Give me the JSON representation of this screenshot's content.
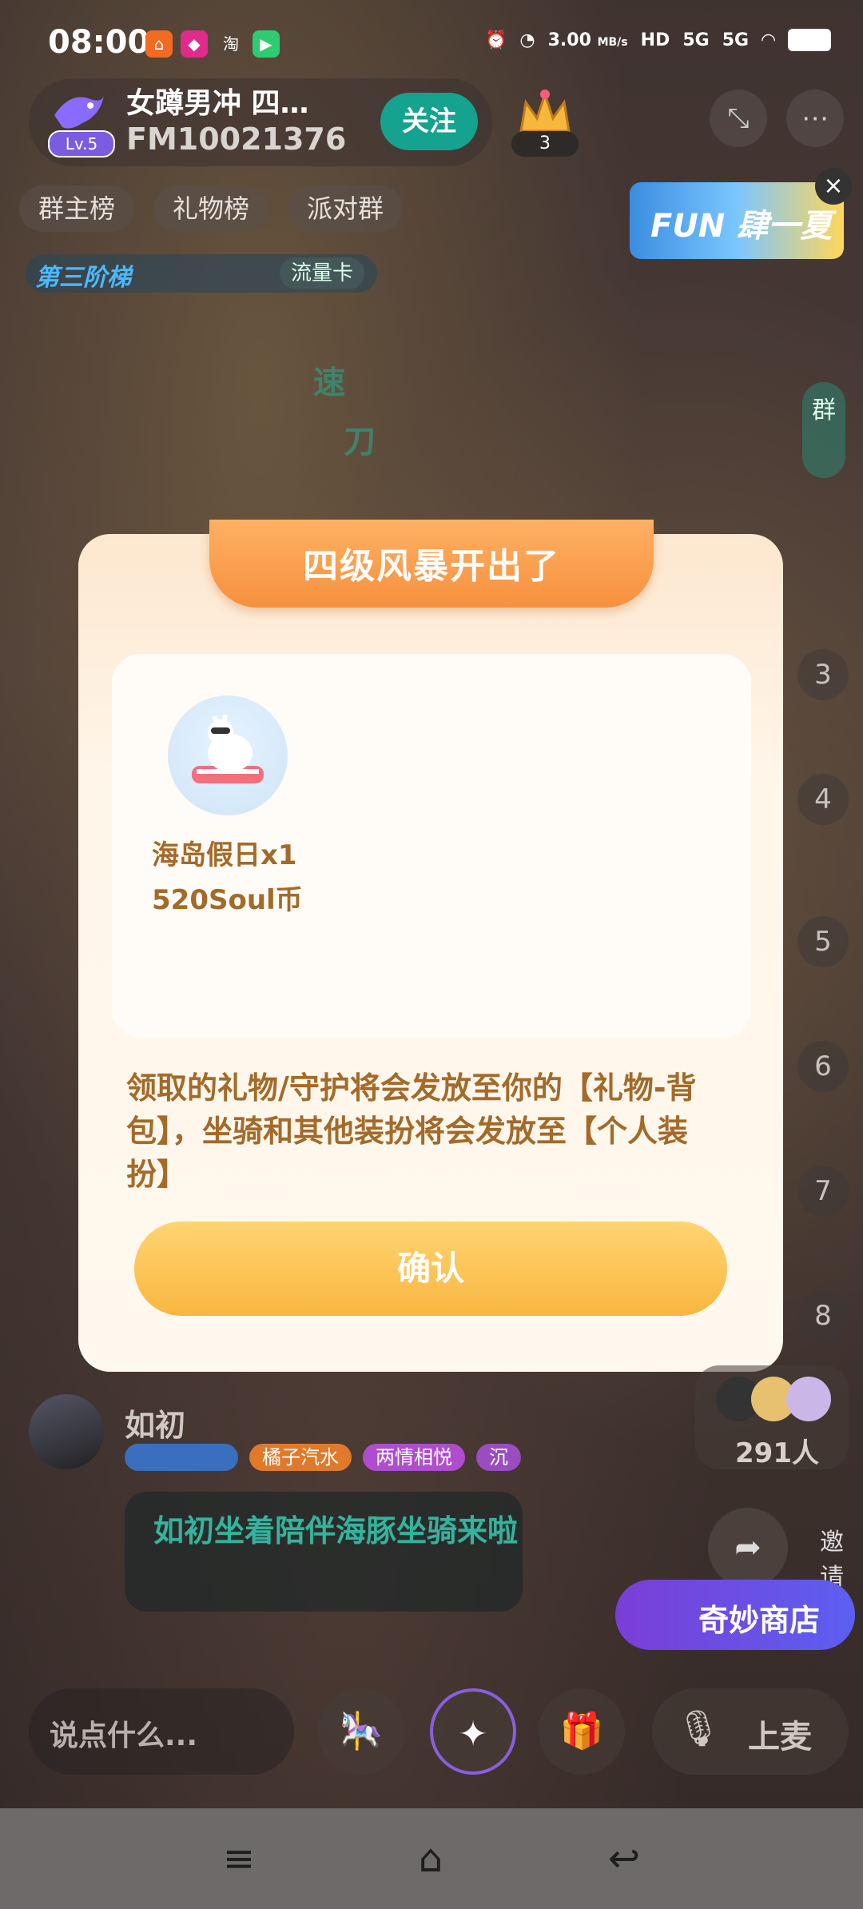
{
  "status_bar": {
    "time": "08:00",
    "app_icons": [
      "home-app-icon",
      "shop-app-icon",
      "淘",
      "video-app-icon"
    ],
    "speed": "3.00",
    "speed_unit": "MB/s",
    "network_labels": [
      "HD",
      "5G",
      "5G"
    ],
    "icons": [
      "alarm-icon",
      "speedometer-icon",
      "wifi-icon",
      "battery-icon"
    ]
  },
  "room": {
    "level": "Lv.5",
    "name": "女蹲男冲  四…",
    "id": "FM10021376",
    "follow_label": "关注",
    "crown_count": "3",
    "tabs": [
      "群主榜",
      "礼物榜",
      "派对群"
    ],
    "stage_label": "第三阶梯",
    "stage_card": "流量卡",
    "banner_text": "FUN 肆一夏",
    "close_symbol": "×",
    "bg_fragment_texts": [
      "速",
      "刀"
    ]
  },
  "mic_seats": [
    "3",
    "4",
    "5",
    "6",
    "7",
    "8"
  ],
  "side_labels": {
    "group": "群"
  },
  "popup": {
    "title": "四级风暴开出了",
    "gift_name": "海岛假日x1",
    "gift_value": "520Soul币",
    "notice": "领取的礼物/守护将会发放至你的【礼物-背包】，坐骑和其他装扮将会发放至【个人装扮】",
    "confirm_label": "确认"
  },
  "chat": {
    "user_name": "如初",
    "badges": [
      "橘子汽水",
      "两情相悦",
      "沉"
    ],
    "message": "如初坐着陪伴海豚坐骑来啦"
  },
  "online": {
    "count": "291人"
  },
  "invite_label": "邀请",
  "shop_label": "奇妙商店",
  "bottom": {
    "input_placeholder": "说点什么...",
    "mic_label": "上麦"
  },
  "colors": {
    "accent_teal": "#15a28e",
    "popup_orange": "#f6913e",
    "confirm_yellow": "#f9b640",
    "text_brown": "#a36a29"
  }
}
